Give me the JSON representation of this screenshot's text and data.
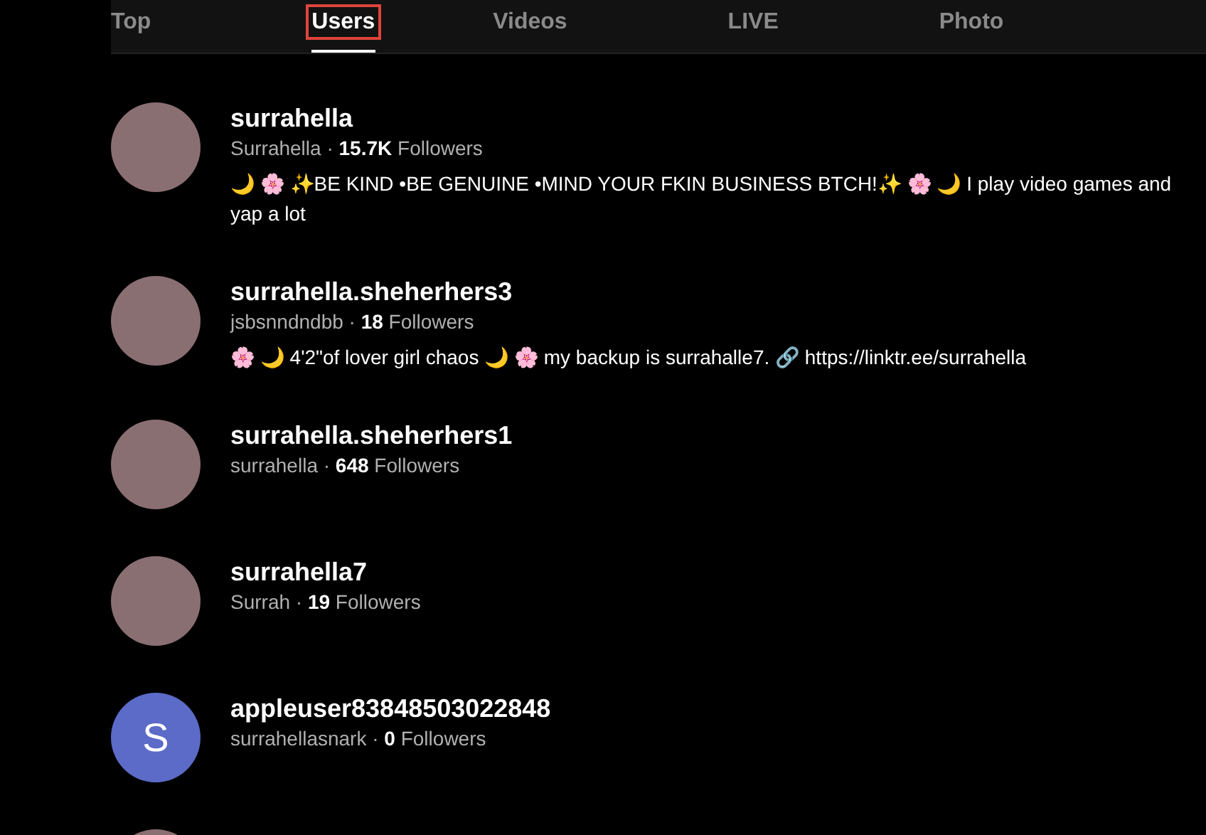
{
  "tabs": [
    {
      "label": "Top",
      "selected": false
    },
    {
      "label": "Users",
      "selected": true
    },
    {
      "label": "Videos",
      "selected": false
    },
    {
      "label": "LIVE",
      "selected": false
    },
    {
      "label": "Photo",
      "selected": false
    }
  ],
  "users": [
    {
      "kind": "photo",
      "name": "surrahella",
      "subtitle": "Surrahella · **15.7K** Followers",
      "bio": "🌙 🌸 ✨BE KIND •BE GENUINE •MIND YOUR FKIN BUSINESS BTCH!✨ 🌸 🌙  I play video games and yap a lot"
    },
    {
      "kind": "photo",
      "name": "surrahella.sheherhers3",
      "subtitle": "jsbsnndndbb · **18** Followers",
      "bio": "🌸 🌙 4'2\"of lover girl chaos 🌙 🌸  my backup is surrahalle7. 🔗 https://linktr.ee/surrahella"
    },
    {
      "kind": "photo",
      "name": "surrahella.sheherhers1",
      "subtitle": "surrahella · **648** Followers"
    },
    {
      "kind": "photo",
      "name": "surrahella7",
      "subtitle": "Surrah · **19** Followers"
    },
    {
      "kind": "letter",
      "letter": "S",
      "color": "#5b6bc7",
      "name": "appleuser83848503022848",
      "subtitle": "surrahellasnark · **0** Followers"
    },
    {
      "kind": "photo"
    }
  ]
}
